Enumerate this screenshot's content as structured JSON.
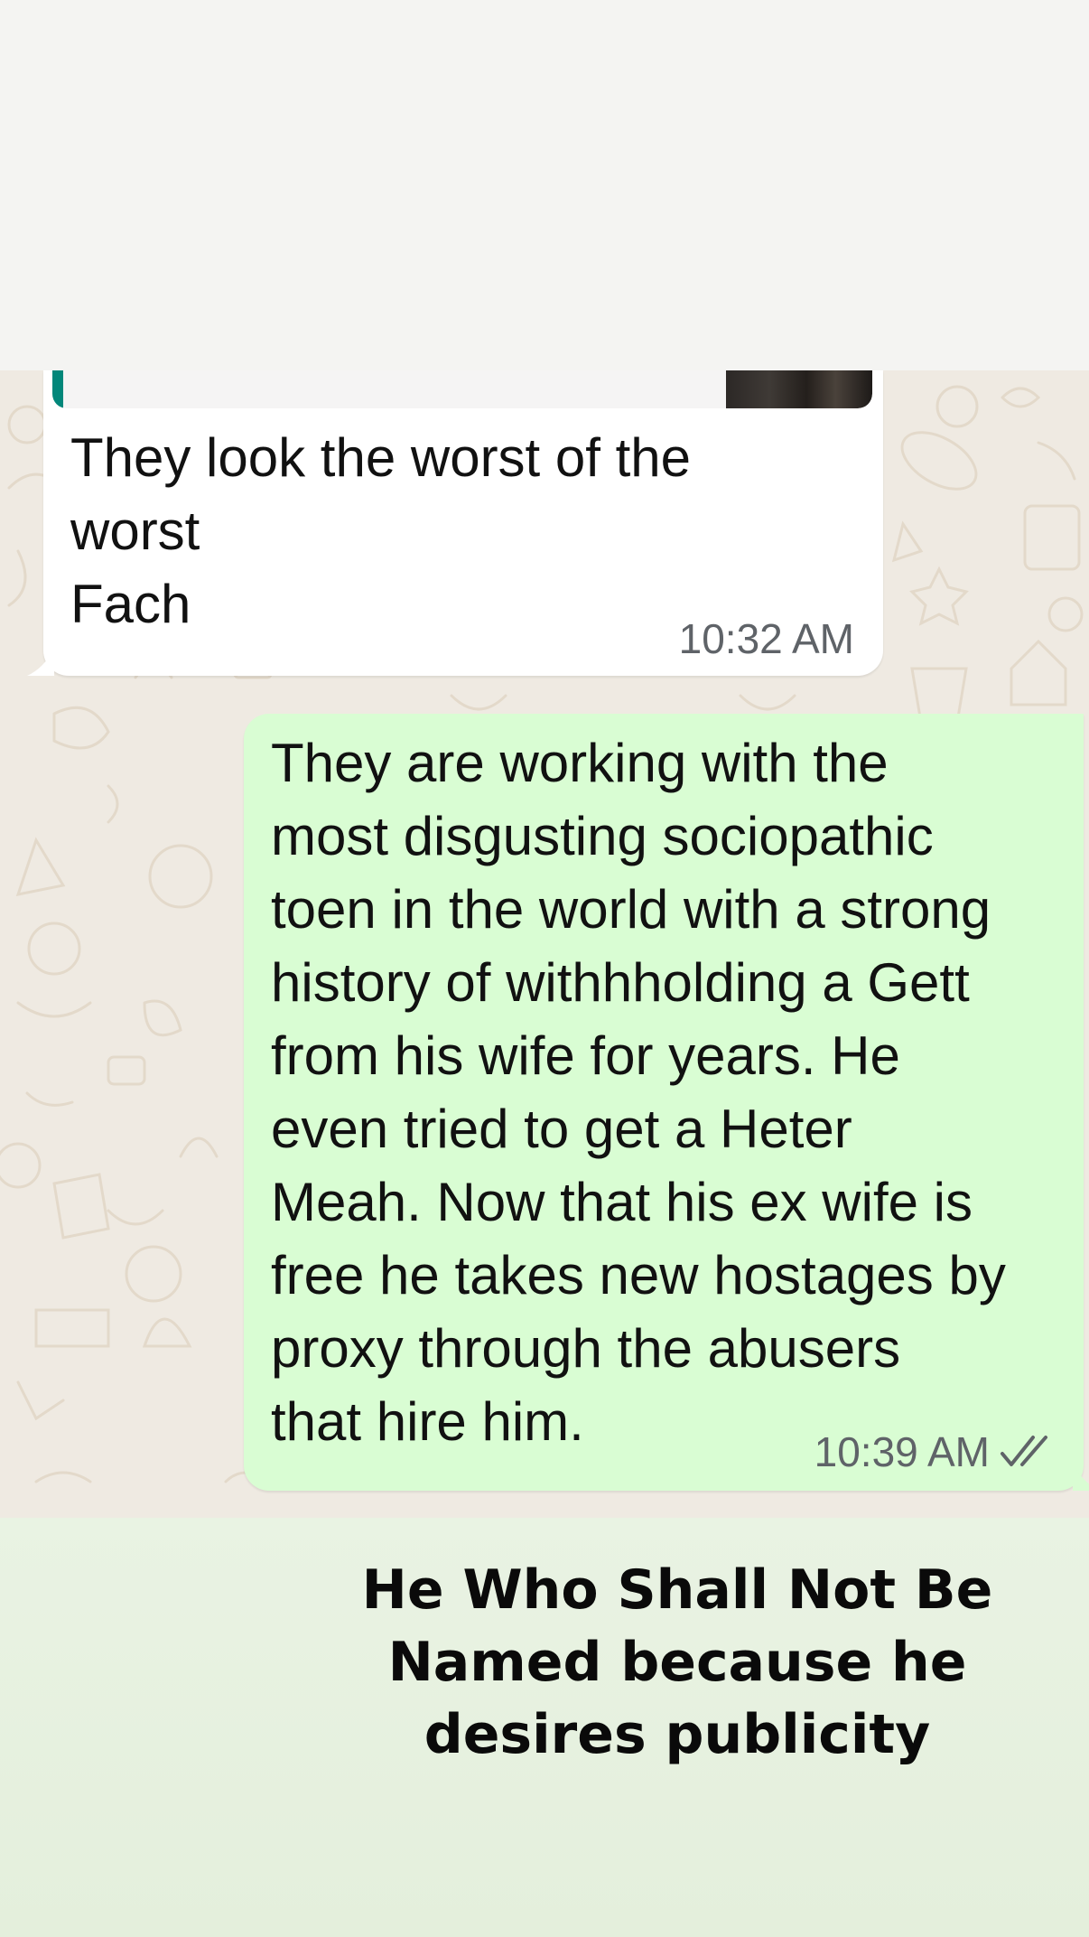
{
  "incoming_message": {
    "text": "They look the worst of the\nworst\nFach",
    "time": "10:32 AM"
  },
  "outgoing_message": {
    "text": "They are working with the\nmost disgusting sociopathic\ntoen in the world with a strong\nhistory of withhholding a Gett\nfrom his wife for years. He\neven tried to get a Heter\nMeah. Now that his ex wife is\nfree he takes new hostages by\nproxy through the abusers\nthat hire him.",
    "time": "10:39 AM",
    "status_icon": "double-check-icon"
  },
  "caption": {
    "text": "He Who Shall Not Be Named because he desires publicity"
  },
  "colors": {
    "incoming_bubble": "#ffffff",
    "outgoing_bubble": "#d9fdd3",
    "quote_bar": "#02877a",
    "chat_wallpaper": "#efeae2",
    "caption_background": "#e6f1df"
  }
}
